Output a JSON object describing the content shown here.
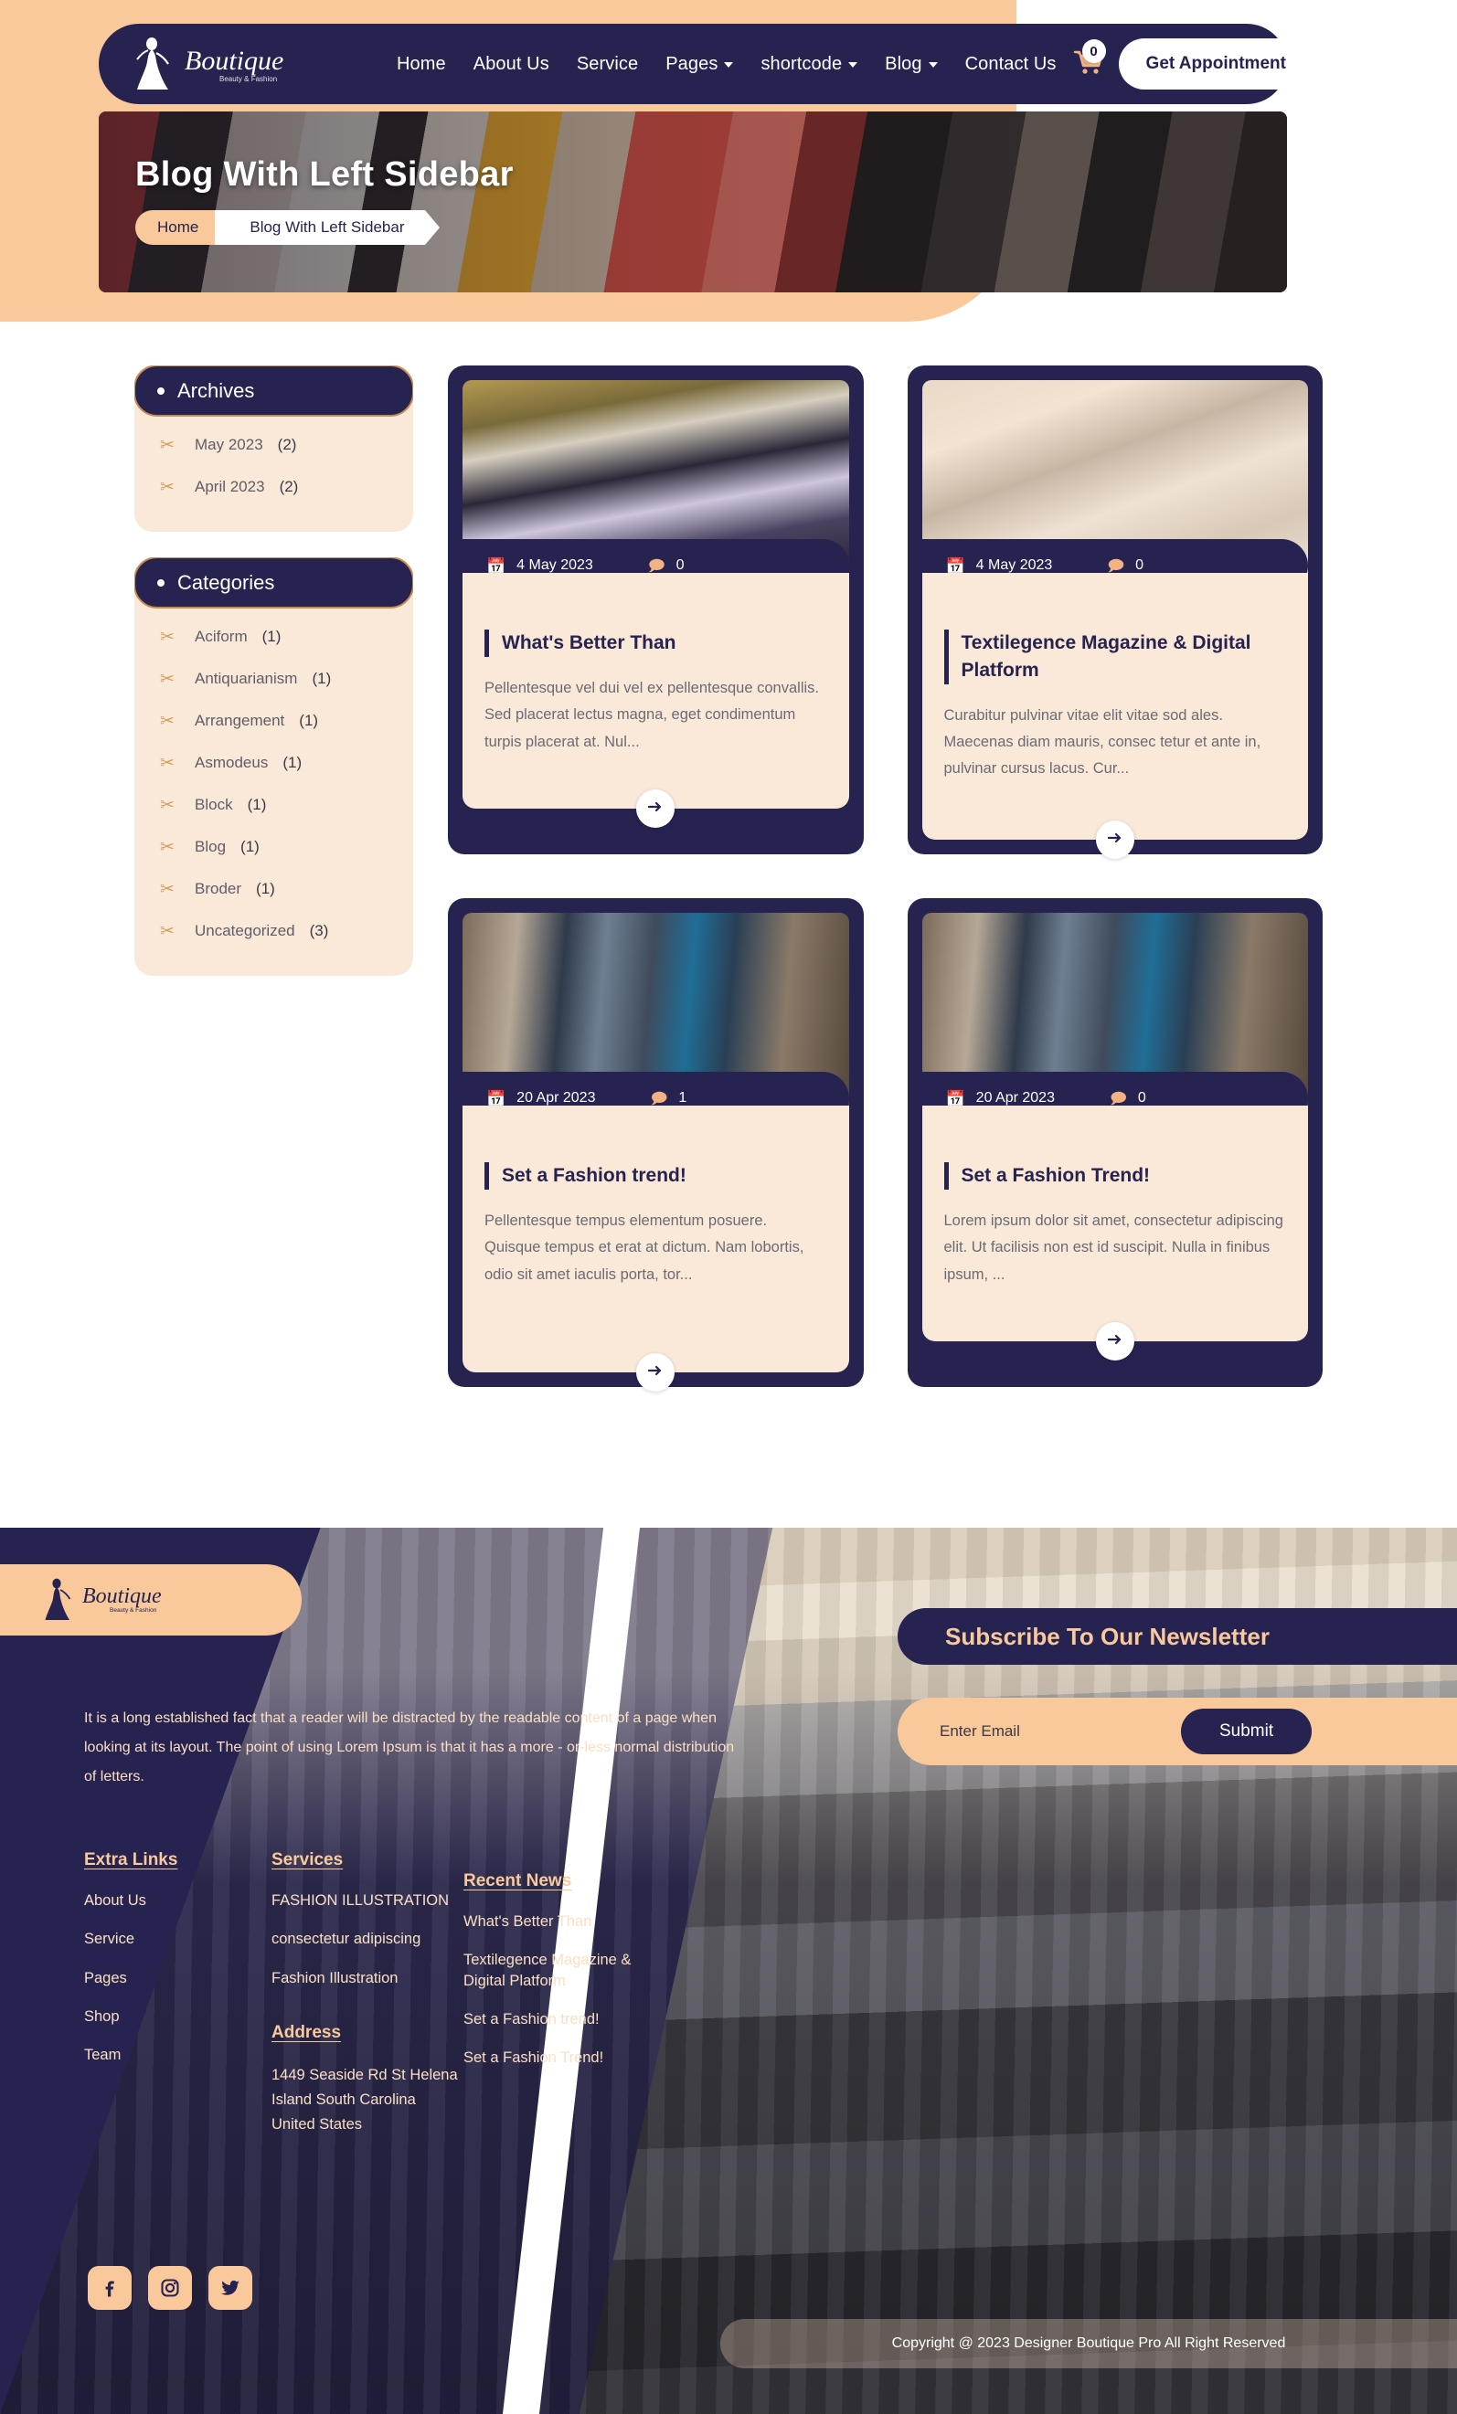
{
  "header": {
    "brand": {
      "name": "Boutique",
      "tagline": "Beauty & Fashion",
      "icon": "boutique-lady-logo"
    },
    "nav": [
      {
        "label": "Home",
        "has_dropdown": false
      },
      {
        "label": "About Us",
        "has_dropdown": false
      },
      {
        "label": "Service",
        "has_dropdown": false
      },
      {
        "label": "Pages",
        "has_dropdown": true
      },
      {
        "label": "shortcode",
        "has_dropdown": true
      },
      {
        "label": "Blog",
        "has_dropdown": true
      },
      {
        "label": "Contact Us",
        "has_dropdown": false
      }
    ],
    "cart": {
      "icon": "shopping-cart-icon",
      "count": "0"
    },
    "appointment_button": "Get Appointment"
  },
  "banner": {
    "title": "Blog With Left Sidebar",
    "breadcrumb": {
      "home": "Home",
      "current": "Blog With Left Sidebar"
    }
  },
  "sidebar": {
    "widgets": [
      {
        "title": "Archives",
        "items": [
          {
            "label": "May 2023",
            "count": "(2)",
            "icon": "scissors-icon"
          },
          {
            "label": "April 2023",
            "count": "(2)",
            "icon": "scissors-icon"
          }
        ]
      },
      {
        "title": "Categories",
        "items": [
          {
            "label": "Aciform",
            "count": "(1)",
            "icon": "scissors-icon"
          },
          {
            "label": "Antiquarianism",
            "count": "(1)",
            "icon": "scissors-icon"
          },
          {
            "label": "Arrangement",
            "count": "(1)",
            "icon": "scissors-icon"
          },
          {
            "label": "Asmodeus",
            "count": "(1)",
            "icon": "scissors-icon"
          },
          {
            "label": "Block",
            "count": "(1)",
            "icon": "scissors-icon"
          },
          {
            "label": "Blog",
            "count": "(1)",
            "icon": "scissors-icon"
          },
          {
            "label": "Broder",
            "count": "(1)",
            "icon": "scissors-icon"
          },
          {
            "label": "Uncategorized",
            "count": "(3)",
            "icon": "scissors-icon"
          }
        ]
      }
    ]
  },
  "posts": [
    {
      "date": "4 May 2023",
      "comments": "0",
      "title": "What's Better Than",
      "excerpt": "Pellentesque vel dui vel ex pellentesque convallis. Sed placerat lectus magna, eget condimentum turpis placerat at. Nul...",
      "date_icon": "calendar-icon",
      "comment_icon": "comment-icon",
      "read_more_icon": "arrow-right-icon"
    },
    {
      "date": "4 May 2023",
      "comments": "0",
      "title": "Textilegence Magazine & Digital Platform",
      "excerpt": "Curabitur pulvinar vitae elit vitae sod ales. Maecenas diam mauris, consec tetur et ante in, pulvinar cursus lacus. Cur...",
      "date_icon": "calendar-icon",
      "comment_icon": "comment-icon",
      "read_more_icon": "arrow-right-icon"
    },
    {
      "date": "20 Apr 2023",
      "comments": "1",
      "title": "Set a Fashion trend!",
      "excerpt": "Pellentesque tempus elementum posuere. Quisque tempus et erat at dictum. Nam lobortis, odio sit amet iaculis porta, tor...",
      "date_icon": "calendar-icon",
      "comment_icon": "comment-icon",
      "read_more_icon": "arrow-right-icon"
    },
    {
      "date": "20 Apr 2023",
      "comments": "0",
      "title": "Set a Fashion Trend!",
      "excerpt": "Lorem ipsum dolor sit amet, consectetur adipiscing elit. Ut facilisis non est id suscipit. Nulla in finibus ipsum, ...",
      "date_icon": "calendar-icon",
      "comment_icon": "comment-icon",
      "read_more_icon": "arrow-right-icon"
    }
  ],
  "newsletter": {
    "title": "Subscribe To Our Newsletter",
    "placeholder": "Enter Email",
    "value": "",
    "submit": "Submit"
  },
  "footer": {
    "brand": {
      "name": "Boutique",
      "tagline": "Beauty & Fashion"
    },
    "description": "It is a long established fact that a reader will be distracted by the readable content of a page when looking at its layout. The point of using Lorem Ipsum is that it has a more - or-less normal distribution of letters.",
    "extra_links": {
      "title": "Extra Links",
      "items": [
        "About Us",
        "Service",
        "Pages",
        "Shop",
        "Team"
      ]
    },
    "services": {
      "title": "Services",
      "items": [
        "FASHION ILLUSTRATION",
        "consectetur adipiscing",
        "Fashion Illustration"
      ]
    },
    "address": {
      "title": "Address",
      "lines": "1449 Seaside Rd St Helena Island South Carolina United States"
    },
    "recent_news": {
      "title": "Recent News",
      "items": [
        "What's Better Than",
        "Textilegence Magazine & Digital Platform",
        "Set a Fashion trend!",
        "Set a Fashion Trend!"
      ]
    },
    "socials": [
      {
        "name": "facebook-icon",
        "glyph": "f"
      },
      {
        "name": "instagram-icon",
        "glyph": "◎"
      },
      {
        "name": "twitter-icon",
        "glyph": "✦"
      }
    ],
    "copyright": "Copyright @ 2023 Designer Boutique Pro All Right Reserved"
  },
  "colors": {
    "navy": "#262350",
    "peach": "#f9c89b",
    "cream": "#fae8d8",
    "accent": "#d79c5e"
  }
}
